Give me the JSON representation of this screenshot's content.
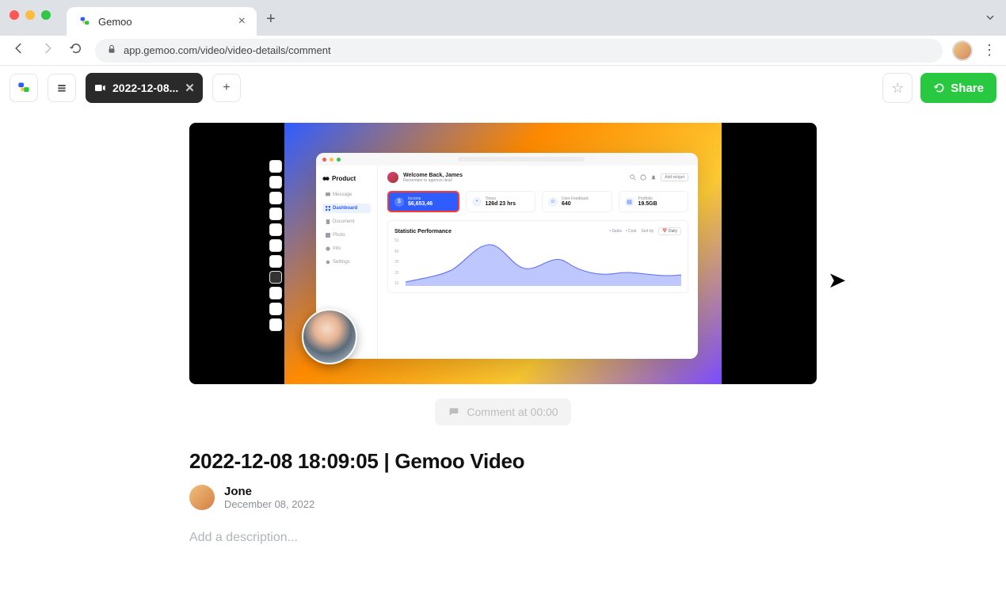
{
  "browser": {
    "tab_title": "Gemoo",
    "url": "app.gemoo.com/video/video-details/comment"
  },
  "app": {
    "tab_label": "2022-12-08...",
    "share_label": "Share"
  },
  "video": {
    "dashboard": {
      "brand": "Product",
      "nav": [
        "Message",
        "Dashboard",
        "Document",
        "Photo",
        "Info",
        "Settings"
      ],
      "nav_active": "Dashboard",
      "welcome_title": "Welcome Back, James",
      "welcome_sub": "Remember to approve deal!",
      "add_widget": "Add widget",
      "cards": [
        {
          "label": "Income",
          "value": "$6,653,46"
        },
        {
          "label": "Times",
          "value": "126d 23 hrs"
        },
        {
          "label": "User Feedback",
          "value": "640"
        },
        {
          "label": "Portfolio",
          "value": "19.5GB"
        }
      ],
      "stat_title": "Statistic Performance",
      "legend": [
        "Sales",
        "Cost"
      ],
      "sortby_label": "Sort by",
      "daily_label": "Daily",
      "y_ticks": [
        "50",
        "40",
        "30",
        "20",
        "10"
      ]
    },
    "comment_button": "Comment at 00:00"
  },
  "meta": {
    "title": "2022-12-08 18:09:05 | Gemoo Video",
    "author": "Jone",
    "date": "December  08, 2022",
    "desc_placeholder": "Add a description..."
  }
}
